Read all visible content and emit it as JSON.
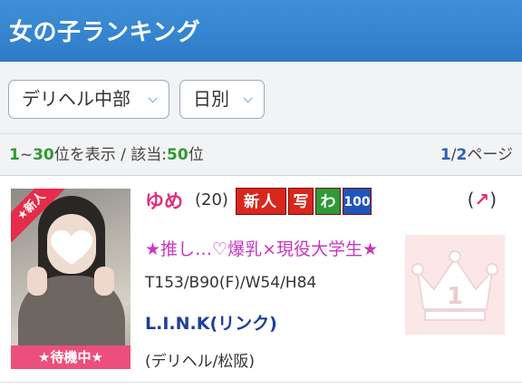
{
  "header": {
    "title": "女の子ランキング"
  },
  "filters": {
    "area": "デリヘル中部",
    "period": "日別"
  },
  "count": {
    "range_start": "1",
    "range_sep": "~",
    "range_end": "30",
    "range_suffix": "位を表示 / 該当:",
    "total": "50",
    "total_suffix": "位",
    "page_current": "1",
    "page_sep": "/",
    "page_total": "2",
    "page_suffix": "ページ"
  },
  "entry": {
    "badge_new": "★新人",
    "standby": "★待機中★",
    "name": "ゆめ",
    "age": "(20)",
    "icons": [
      "新人",
      "写",
      "わ",
      "100"
    ],
    "trend_open": "(",
    "trend_arrow": "↗",
    "trend_close": ")",
    "catch": "★推し…♡爆乳×現役大学生★",
    "size": "T153/B90(F)/W54/H84",
    "shop": "L.I.N.K(リンク)",
    "area": "(デリヘル/松阪)",
    "rank": "1"
  },
  "icons_meta": {
    "chevron": "chevron-down-icon",
    "crown": "crown-icon"
  },
  "colors": {
    "header": "#3484d0",
    "name": "#e0307a",
    "catch": "#c837c0",
    "shop": "#1f3f9a",
    "green": "#2e9a2e"
  }
}
